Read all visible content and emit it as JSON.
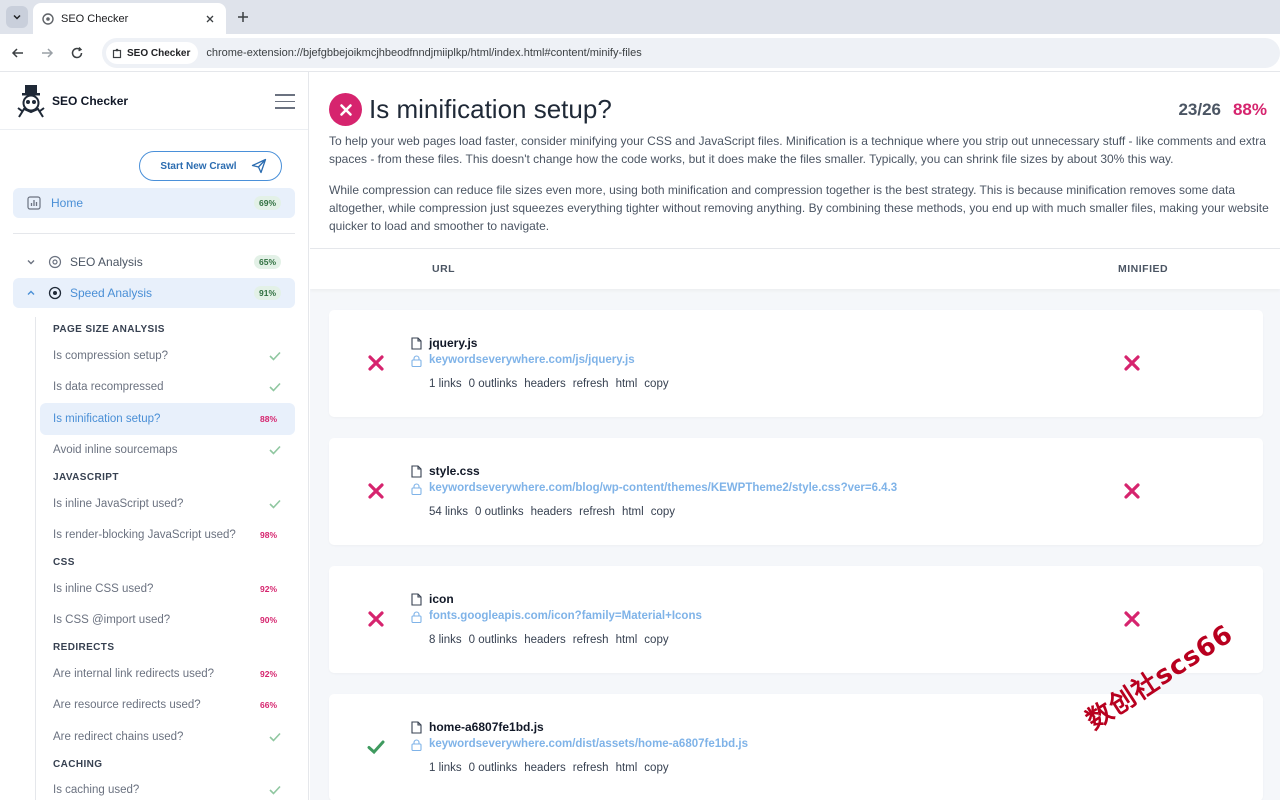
{
  "browser": {
    "tab_title": "SEO Checker",
    "chip_label": "SEO Checker",
    "url": "chrome-extension://bjefgbbejoikmcjhbeodfnndjmiiplkp/html/index.html#content/minify-files"
  },
  "sidebar": {
    "brand": "SEO Checker",
    "crawl_button": "Start New Crawl",
    "home": {
      "label": "Home",
      "badge": "69%"
    },
    "sections": [
      {
        "label": "SEO Analysis",
        "badge": "65%"
      },
      {
        "label": "Speed Analysis",
        "badge": "91%"
      }
    ],
    "groups": [
      {
        "heading": "PAGE SIZE ANALYSIS",
        "items": [
          {
            "label": "Is compression setup?",
            "status": "check"
          },
          {
            "label": "Is data recompressed",
            "status": "check"
          },
          {
            "label": "Is minification setup?",
            "status": "88%"
          },
          {
            "label": "Avoid inline sourcemaps",
            "status": "check"
          }
        ]
      },
      {
        "heading": "JAVASCRIPT",
        "items": [
          {
            "label": "Is inline JavaScript used?",
            "status": "check"
          },
          {
            "label": "Is render-blocking JavaScript used?",
            "status": "98%"
          }
        ]
      },
      {
        "heading": "CSS",
        "items": [
          {
            "label": "Is inline CSS used?",
            "status": "92%"
          },
          {
            "label": "Is CSS @import used?",
            "status": "90%"
          }
        ]
      },
      {
        "heading": "REDIRECTS",
        "items": [
          {
            "label": "Are internal link redirects used?",
            "status": "92%"
          },
          {
            "label": "Are resource redirects used?",
            "status": "66%"
          },
          {
            "label": "Are redirect chains used?",
            "status": "check"
          }
        ]
      },
      {
        "heading": "CACHING",
        "items": [
          {
            "label": "Is caching used?",
            "status": "check"
          }
        ]
      }
    ]
  },
  "main": {
    "title": "Is minification setup?",
    "score": "23/26",
    "percent": "88%",
    "desc1": "To help your web pages load faster, consider minifying your CSS and JavaScript files. Minification is a technique where you strip out unnecessary stuff - like comments and extra spaces - from these files. This doesn't change how the code works, but it does make the files smaller. Typically, you can shrink file sizes by about 30% this way.",
    "desc2": "While compression can reduce file sizes even more, using both minification and compression together is the best strategy. This is because minification removes some data altogether, while compression just squeezes everything tighter without removing anything. By combining these methods, you end up with much smaller files, making your website quicker to load and smoother to navigate.",
    "col_url": "URL",
    "col_minified": "MINIFIED",
    "rows": [
      {
        "name": "jquery.js",
        "url": "keywordseverywhere.com/js/jquery.js",
        "links": "1 links",
        "outlinks": "0 outlinks",
        "status": "fail",
        "minified": "fail"
      },
      {
        "name": "style.css",
        "url": "keywordseverywhere.com/blog/wp-content/themes/KEWPTheme2/style.css?ver=6.4.3",
        "links": "54 links",
        "outlinks": "0 outlinks",
        "status": "fail",
        "minified": "fail"
      },
      {
        "name": "icon",
        "url": "fonts.googleapis.com/icon?family=Material+Icons",
        "links": "8 links",
        "outlinks": "0 outlinks",
        "status": "fail",
        "minified": "fail"
      },
      {
        "name": "home-a6807fe1bd.js",
        "url": "keywordseverywhere.com/dist/assets/home-a6807fe1bd.js",
        "links": "1 links",
        "outlinks": "0 outlinks",
        "status": "pass",
        "minified": "pass"
      }
    ],
    "actions": [
      "headers",
      "refresh",
      "html",
      "copy"
    ]
  },
  "watermark": "数创社scs66",
  "colors": {
    "fail": "#d6246e",
    "pass": "#3f9a5f",
    "accent": "#4a8fd6"
  }
}
